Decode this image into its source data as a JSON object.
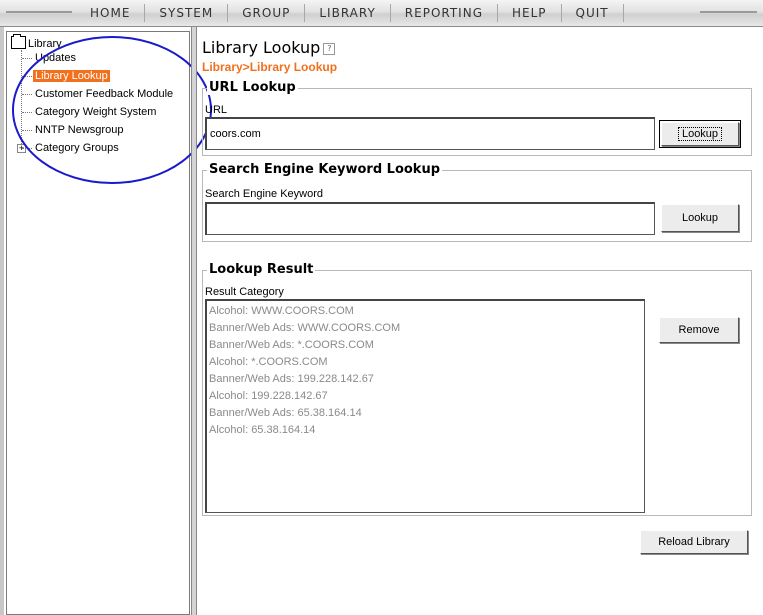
{
  "menu": {
    "items": [
      {
        "label": "HOME"
      },
      {
        "label": "SYSTEM"
      },
      {
        "label": "GROUP"
      },
      {
        "label": "LIBRARY"
      },
      {
        "label": "REPORTING"
      },
      {
        "label": "HELP"
      },
      {
        "label": "QUIT"
      }
    ]
  },
  "tree": {
    "root": "Library",
    "items": [
      {
        "label": "Updates",
        "selected": false
      },
      {
        "label": "Library Lookup",
        "selected": true
      },
      {
        "label": "Customer Feedback Module",
        "selected": false
      },
      {
        "label": "Category Weight System",
        "selected": false
      },
      {
        "label": "NNTP Newsgroup",
        "selected": false
      },
      {
        "label": "Category Groups",
        "selected": false,
        "expandable": true
      }
    ]
  },
  "page": {
    "title": "Library Lookup",
    "breadcrumb": "Library>Library Lookup"
  },
  "url_lookup": {
    "legend": "URL Lookup",
    "field_label": "URL",
    "value": "coors.com",
    "button": "Lookup"
  },
  "keyword_lookup": {
    "legend": "Search Engine Keyword Lookup",
    "field_label": "Search Engine Keyword",
    "value": "",
    "button": "Lookup"
  },
  "lookup_result": {
    "legend": "Lookup Result",
    "field_label": "Result Category",
    "rows": [
      {
        "text": "Alcohol:   WWW.COORS.COM"
      },
      {
        "text": "Banner/Web Ads:   WWW.COORS.COM"
      },
      {
        "text": "Banner/Web Ads:   *.COORS.COM"
      },
      {
        "text": "Alcohol:   *.COORS.COM"
      },
      {
        "text": "Banner/Web Ads:   199.228.142.67"
      },
      {
        "text": "Alcohol:   199.228.142.67"
      },
      {
        "text": "Banner/Web Ads:   65.38.164.14"
      },
      {
        "text": "Alcohol:   65.38.164.14"
      }
    ],
    "remove_button": "Remove"
  },
  "reload_button": "Reload Library",
  "colors": {
    "accent": "#f0701e",
    "annotation": "#1a1acc"
  }
}
